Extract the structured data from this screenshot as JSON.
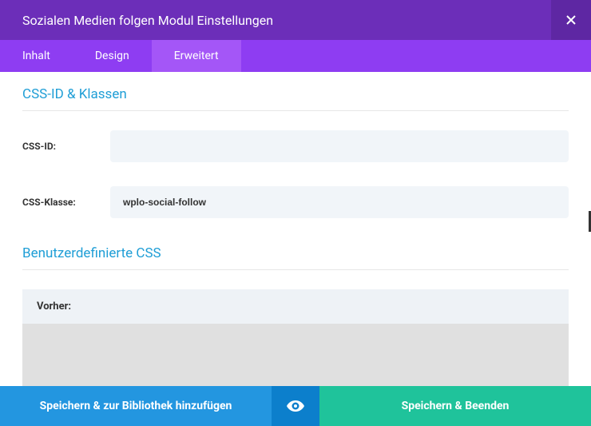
{
  "header": {
    "title": "Sozialen Medien folgen Modul Einstellungen"
  },
  "tabs": {
    "inhalt": "Inhalt",
    "design": "Design",
    "erweitert": "Erweitert"
  },
  "sections": {
    "css_id_klassen": "CSS-ID & Klassen",
    "benutzerdefinierte_css": "Benutzerdefinierte CSS"
  },
  "fields": {
    "css_id_label": "CSS-ID:",
    "css_id_value": "",
    "css_klasse_label": "CSS-Klasse:",
    "css_klasse_value": "wplo-social-follow"
  },
  "code": {
    "vorher_label": "Vorher:"
  },
  "footer": {
    "save_library": "Speichern & zur Bibliothek hinzufügen",
    "save_exit": "Speichern & Beenden"
  }
}
